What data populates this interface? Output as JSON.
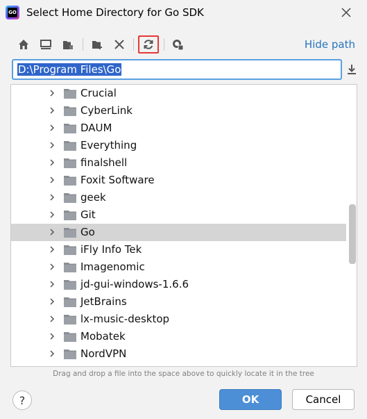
{
  "window": {
    "title": "Select Home Directory for Go SDK",
    "app_icon_text": "GO"
  },
  "toolbar": {
    "hide_path_label": "Hide path",
    "icons": [
      "home-icon",
      "desktop-icon",
      "project-icon",
      "new-folder-icon",
      "delete-icon",
      "refresh-icon",
      "show-hidden-icon"
    ],
    "active_icon": "refresh-icon"
  },
  "path": {
    "value": "D:\\Program Files\\Go"
  },
  "tree": {
    "selected_label": "Go",
    "items": [
      {
        "label": "Crucial"
      },
      {
        "label": "CyberLink"
      },
      {
        "label": "DAUM"
      },
      {
        "label": "Everything"
      },
      {
        "label": "finalshell"
      },
      {
        "label": "Foxit Software"
      },
      {
        "label": "geek"
      },
      {
        "label": "Git"
      },
      {
        "label": "Go"
      },
      {
        "label": "iFly Info Tek"
      },
      {
        "label": "Imagenomic"
      },
      {
        "label": "jd-gui-windows-1.6.6"
      },
      {
        "label": "JetBrains"
      },
      {
        "label": "lx-music-desktop"
      },
      {
        "label": "Mobatek"
      },
      {
        "label": "NordVPN"
      }
    ]
  },
  "hint": "Drag and drop a file into the space above to quickly locate it in the tree",
  "buttons": {
    "help": "?",
    "ok": "OK",
    "cancel": "Cancel"
  },
  "colors": {
    "accent": "#2675bf",
    "selection": "#2f65ca",
    "ok_button": "#4d8fd6",
    "highlight_border": "#e53935"
  }
}
